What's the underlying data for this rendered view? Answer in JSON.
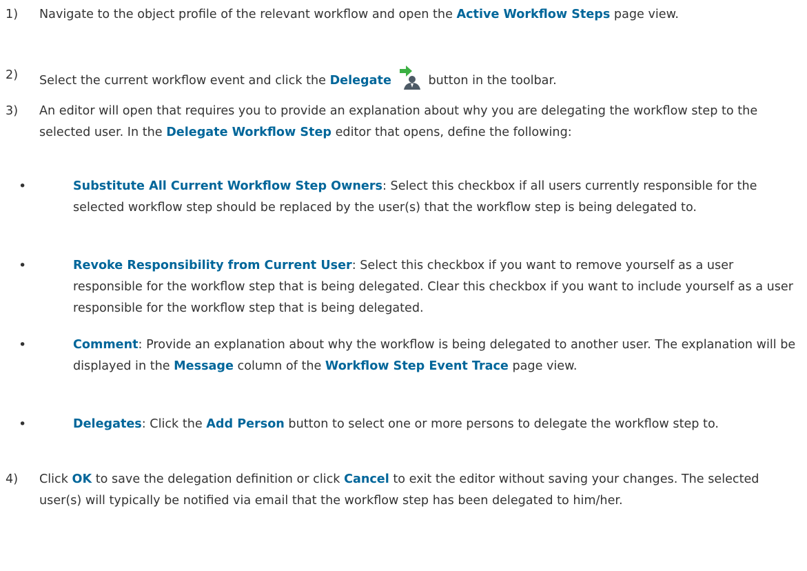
{
  "steps": [
    {
      "num": "1)",
      "parts": [
        {
          "t": "Navigate to the object profile of the relevant workflow and open the "
        },
        {
          "b": "Active Workflow Steps"
        },
        {
          "t": " page view."
        }
      ]
    },
    {
      "num": "2)",
      "parts": [
        {
          "t": "Select the current workflow event and click the "
        },
        {
          "b": "Delegate"
        },
        {
          "icon": "delegate-icon"
        },
        {
          "t": " button in the toolbar."
        }
      ]
    },
    {
      "num": "3)",
      "parts": [
        {
          "t": "An editor will open that requires you to provide an explanation about why you are delegating the workflow step to the selected user. In the "
        },
        {
          "b": "Delegate Workflow Step"
        },
        {
          "t": " editor that opens, define the following:"
        }
      ]
    },
    {
      "num": "4)",
      "parts": [
        {
          "t": "Click "
        },
        {
          "b": "OK"
        },
        {
          "t": " to save the delegation definition or click "
        },
        {
          "b": "Cancel"
        },
        {
          "t": " to exit the editor without saving your changes. The selected user(s) will typically be notified via email that the workflow step has been delegated to him/her."
        }
      ]
    }
  ],
  "bullets": [
    {
      "parts": [
        {
          "b": "Substitute All Current Workflow Step Owners"
        },
        {
          "t": ": Select this checkbox if all users currently responsible for the selected workflow step should be replaced by the user(s) that the workflow step is being delegated to."
        }
      ]
    },
    {
      "parts": [
        {
          "b": "Revoke Responsibility from Current User"
        },
        {
          "t": ": Select this checkbox if you want to remove yourself as a user responsible for the workflow step that is being delegated. Clear this checkbox if you want to include yourself as a user responsible for the workflow step that is being delegated."
        }
      ]
    },
    {
      "parts": [
        {
          "b": "Comment"
        },
        {
          "t": ": Provide an explanation about why the workflow is being delegated to another user. The explanation will be displayed in the "
        },
        {
          "b": "Message"
        },
        {
          "t": " column of the "
        },
        {
          "b": "Workflow Step Event Trace"
        },
        {
          "t": " page view."
        }
      ]
    },
    {
      "parts": [
        {
          "b": "Delegates"
        },
        {
          "t": ": Click the "
        },
        {
          "b": "Add Person"
        },
        {
          "t": " button to select one or more persons to delegate the workflow step to."
        }
      ]
    }
  ],
  "colors": {
    "text": "#333333",
    "emphasis": "#00669a",
    "icon_arrow": "#3cb043",
    "icon_person": "#4d5a66"
  }
}
